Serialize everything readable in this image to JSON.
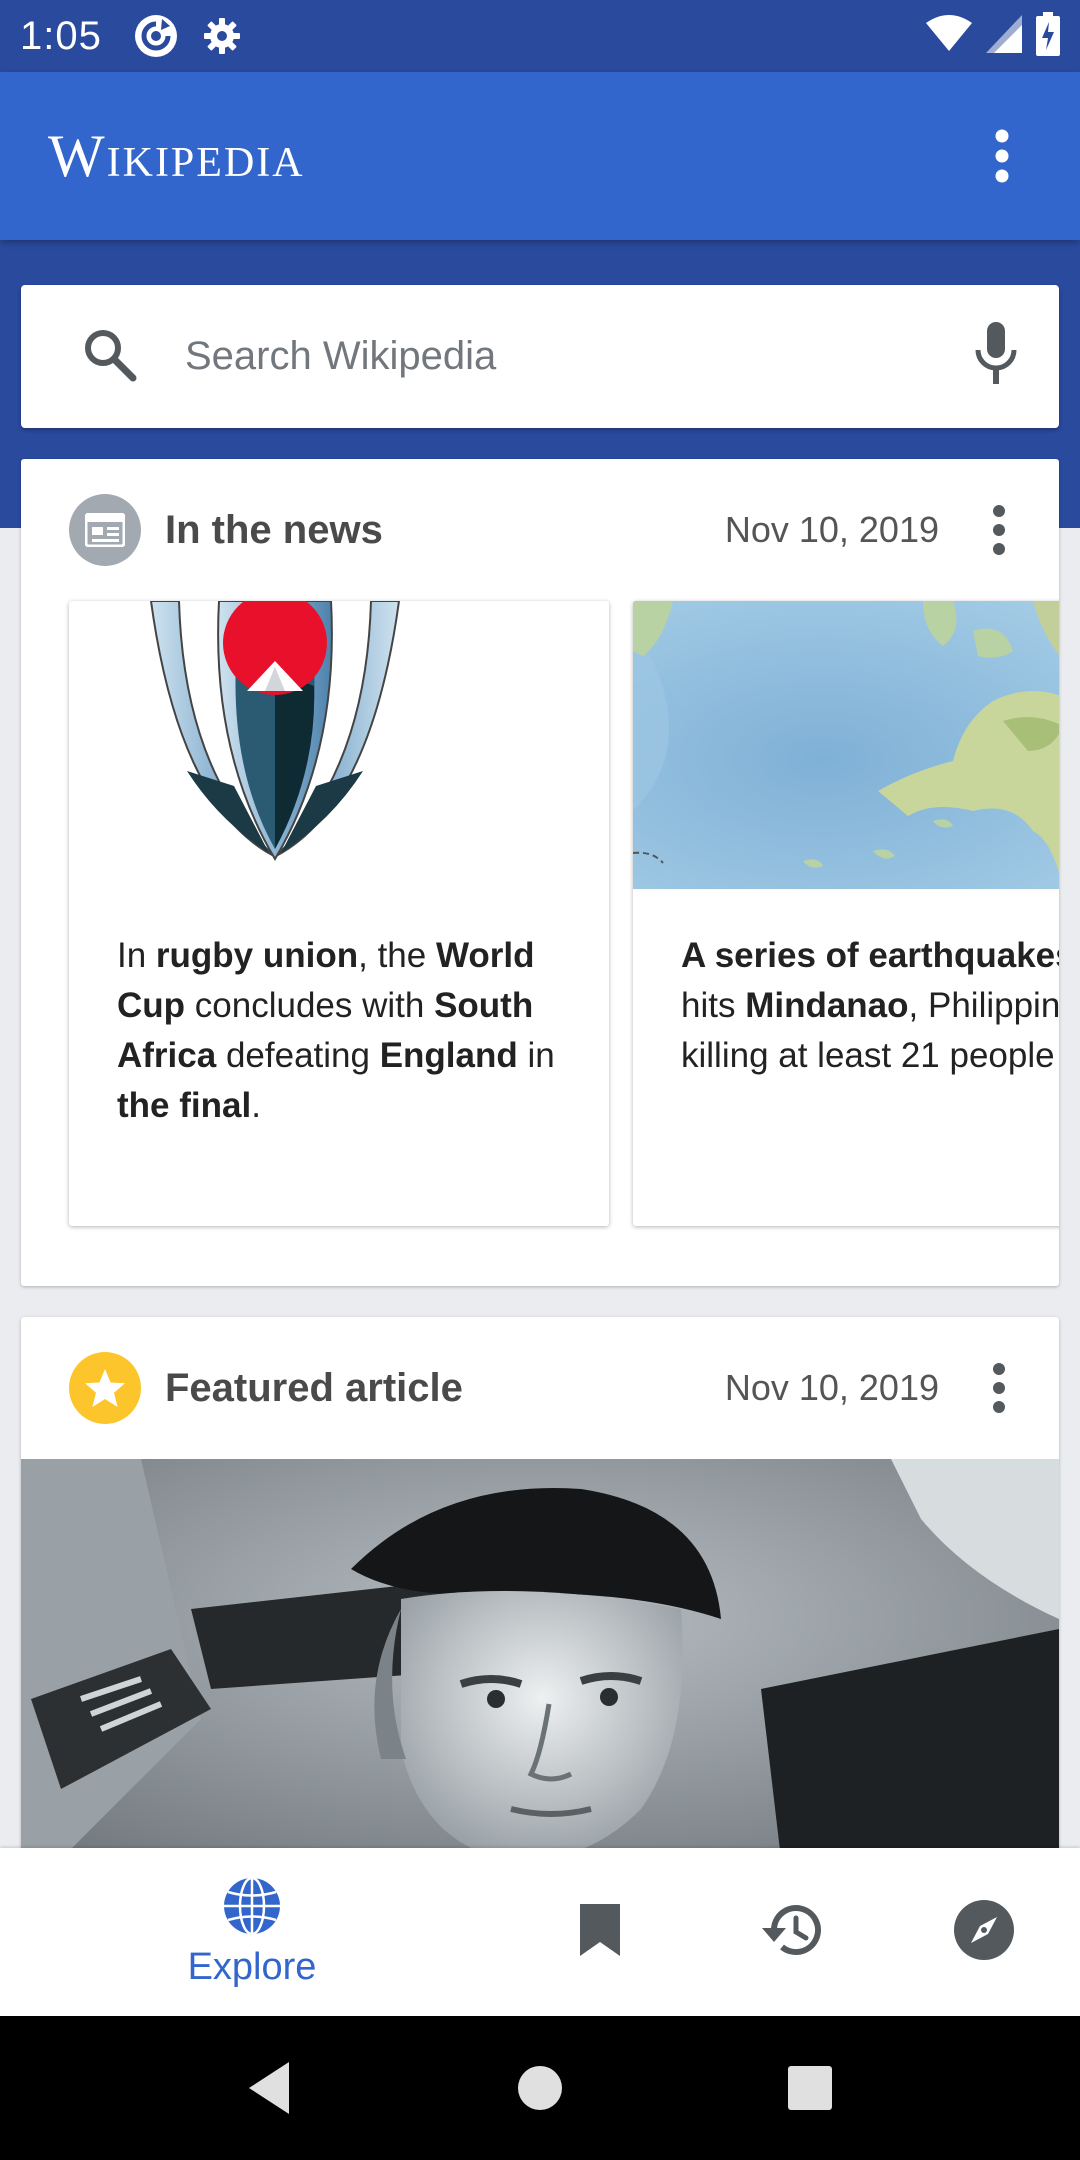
{
  "status_bar": {
    "time": "1:05",
    "icons": [
      "sync-icon",
      "gear-icon",
      "wifi-icon",
      "signal-icon",
      "battery-icon"
    ]
  },
  "app_bar": {
    "title": "Wikipedia",
    "menu_icon": "more-vert-icon"
  },
  "search": {
    "placeholder": "Search Wikipedia",
    "icon": "search-icon",
    "voice_icon": "mic-icon"
  },
  "news_card": {
    "title": "In the news",
    "date": "Nov 10, 2019",
    "icon": "newspaper-icon",
    "items": [
      {
        "image": "rugby-world-cup-logo",
        "parts": [
          {
            "t": "In ",
            "b": false
          },
          {
            "t": "rugby union",
            "b": true
          },
          {
            "t": ", the ",
            "b": false
          },
          {
            "t": "World Cup",
            "b": true
          },
          {
            "t": " concludes with ",
            "b": false
          },
          {
            "t": "South Africa",
            "b": true
          },
          {
            "t": " defeating ",
            "b": false
          },
          {
            "t": "England",
            "b": true
          },
          {
            "t": " in ",
            "b": false
          },
          {
            "t": "the final",
            "b": true
          },
          {
            "t": ".",
            "b": false
          }
        ]
      },
      {
        "image": "mindanao-map",
        "lines": [
          [
            {
              "t": "A series of earthquakes",
              "b": true
            }
          ],
          [
            {
              "t": "hits ",
              "b": false
            },
            {
              "t": "Mindanao",
              "b": true
            },
            {
              "t": ", Philippin",
              "b": false
            }
          ],
          [
            {
              "t": "killing at least 21 people",
              "b": false
            }
          ]
        ]
      }
    ]
  },
  "featured_card": {
    "title": "Featured article",
    "date": "Nov 10, 2019",
    "icon": "star-icon"
  },
  "bottom_nav": {
    "items": [
      {
        "label": "Explore",
        "icon": "globe-icon",
        "active": true
      },
      {
        "label": "",
        "icon": "bookmark-icon",
        "active": false
      },
      {
        "label": "",
        "icon": "history-icon",
        "active": false
      },
      {
        "label": "",
        "icon": "compass-icon",
        "active": false
      }
    ]
  },
  "system_nav": [
    "back-icon",
    "home-icon",
    "recents-icon"
  ],
  "colors": {
    "status_bar": "#2a4a9e",
    "app_bar": "#3366cc",
    "accent": "#3366cc",
    "star": "#fcc52c"
  }
}
